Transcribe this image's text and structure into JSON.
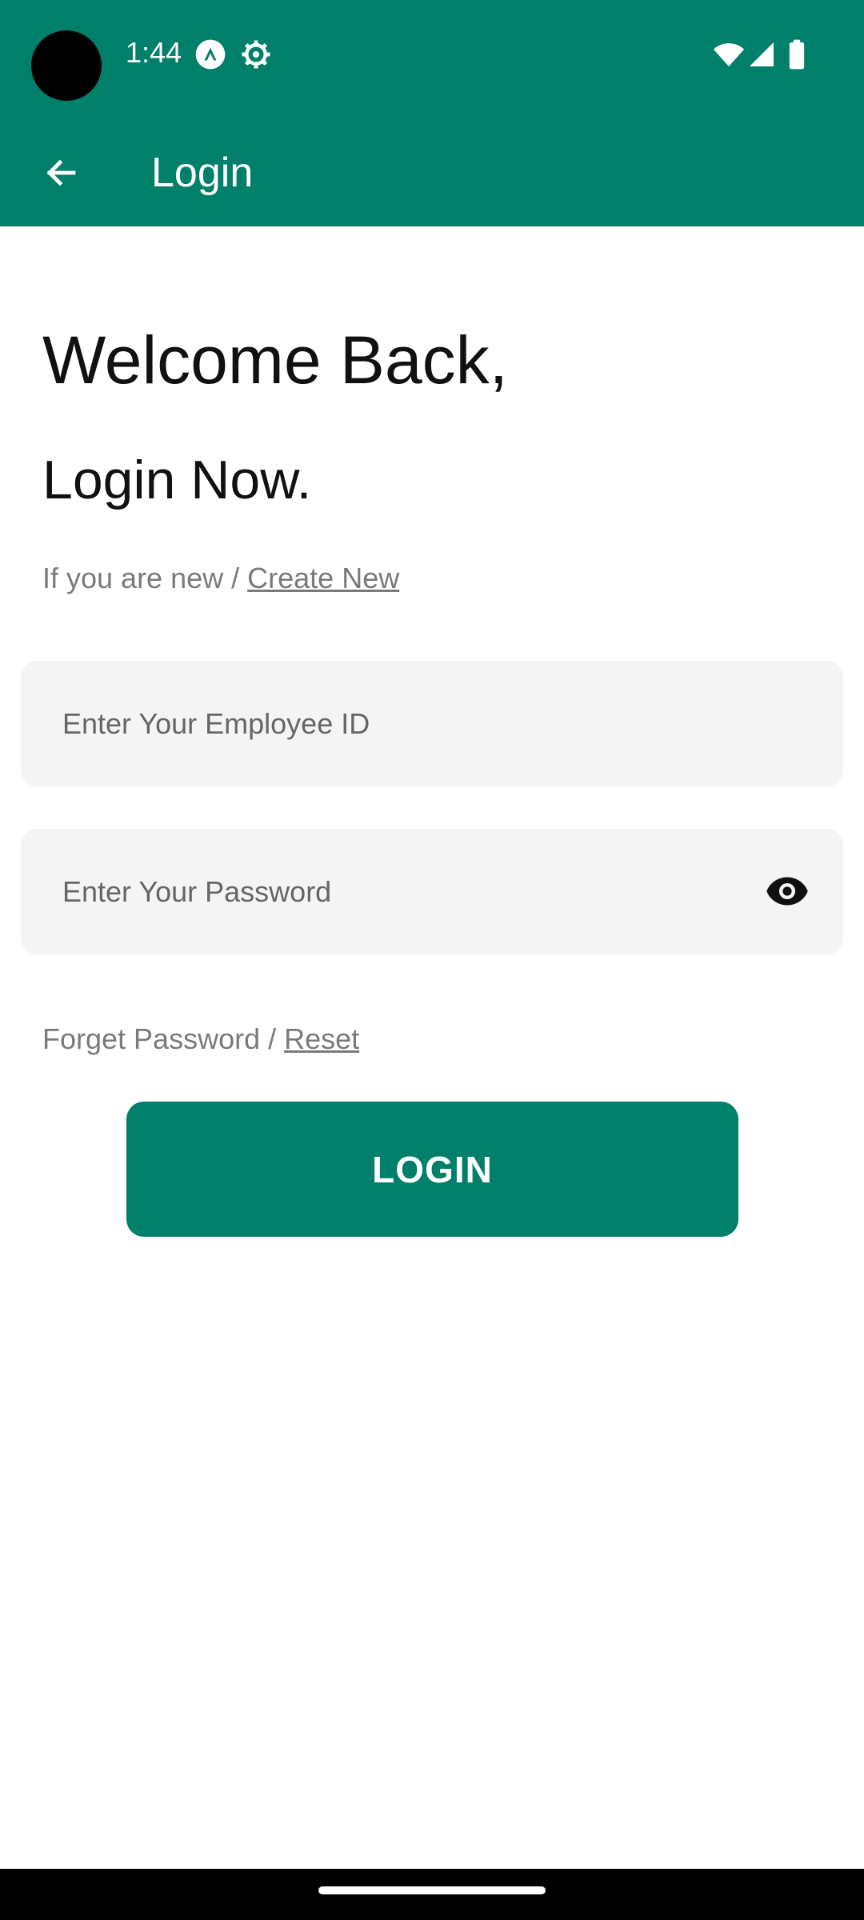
{
  "status_bar": {
    "time": "1:44",
    "icons": [
      "app-notification-icon",
      "settings-gear-icon",
      "wifi-icon",
      "cellular-signal-icon",
      "battery-icon"
    ]
  },
  "app_bar": {
    "title": "Login",
    "back_icon": "arrow-back-icon"
  },
  "content": {
    "welcome": "Welcome Back,",
    "login_now": "Login Now.",
    "new_user_prefix": "If you are new / ",
    "create_new_link": "Create New",
    "employee_id_placeholder": "Enter Your Employee ID",
    "employee_id_value": "",
    "password_placeholder": "Enter Your Password",
    "password_value": "",
    "password_toggle_icon": "eye-icon",
    "forget_prefix": "Forget Password / ",
    "reset_link": "Reset",
    "login_button": "LOGIN"
  },
  "colors": {
    "primary": "#00806B",
    "input_background": "#f4f4f4",
    "secondary_text": "#7a7a7a"
  }
}
